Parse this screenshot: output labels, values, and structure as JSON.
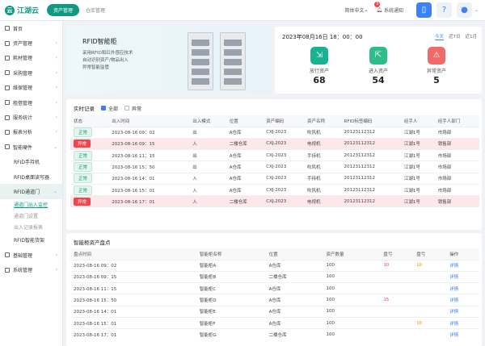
{
  "app": {
    "logo_mark": "云",
    "logo": "江湖云",
    "nav": [
      "资产管理",
      "仓库管理"
    ]
  },
  "topbar": {
    "lang": "简体中文",
    "notify": "系统通知",
    "notify_count": "5"
  },
  "sidebar": {
    "items": [
      {
        "label": "首页",
        "type": "top"
      },
      {
        "label": "资产管理",
        "type": "top",
        "chev": "›"
      },
      {
        "label": "耗材管理",
        "type": "top",
        "chev": "›"
      },
      {
        "label": "采购管理",
        "type": "top",
        "chev": "›"
      },
      {
        "label": "维保管理",
        "type": "top",
        "chev": "›"
      },
      {
        "label": "租借管理",
        "type": "top",
        "chev": "›"
      },
      {
        "label": "服务统计",
        "type": "top",
        "chev": "›"
      },
      {
        "label": "报表分析",
        "type": "top",
        "chev": "›"
      },
      {
        "label": "智能硬件",
        "type": "top",
        "chev": "⌄"
      },
      {
        "label": "RFID手持机",
        "type": "sub"
      },
      {
        "label": "RFID桌面读写器",
        "type": "sub"
      },
      {
        "label": "RFID通道门",
        "type": "subsel",
        "chev": "⌄"
      },
      {
        "label": "通道门出入监控",
        "type": "leafsel"
      },
      {
        "label": "通道门设置",
        "type": "leaf"
      },
      {
        "label": "出入记录报表",
        "type": "leaf"
      },
      {
        "label": "RFID智能货架",
        "type": "sub"
      },
      {
        "label": "基础管理",
        "type": "top",
        "chev": "›"
      },
      {
        "label": "系统管理",
        "type": "top",
        "chev": "›"
      }
    ]
  },
  "hero": {
    "title": "RFID智能柜",
    "lines": [
      "采用RFID和红外感应技术",
      "自动识别资产/物品出入",
      "异常智能监管"
    ]
  },
  "stats": {
    "date": "2023年08月16日   18：00：00",
    "tabs": [
      "今天",
      "近7日",
      "近1月"
    ],
    "cards": [
      {
        "label": "放行资产",
        "value": "68",
        "color": "#19b28f",
        "icon": "⇲"
      },
      {
        "label": "进入资产",
        "value": "54",
        "color": "#2dbd8a",
        "icon": "⇱"
      },
      {
        "label": "异常资产",
        "value": "5",
        "color": "#f06a6a",
        "icon": "⚠"
      }
    ]
  },
  "realtime": {
    "title": "实时记录",
    "filter_all": "全部",
    "filter_abnormal": "异常",
    "columns": [
      "状态",
      "出入时间",
      "出入模式",
      "位置",
      "资产编码",
      "资产名称",
      "RFID标签编码",
      "经手人",
      "经手人部门"
    ],
    "rows": [
      {
        "status": "正常",
        "time": "2023-08-16  09：02",
        "mode": "出",
        "loc": "A仓库",
        "code": "CXJ-2023",
        "name": "吹风机",
        "rfid": "20123112312",
        "person": "江湖1号",
        "dept": "市场部",
        "abnormal": false
      },
      {
        "status": "异常",
        "time": "2023-08-16  09：15",
        "mode": "入",
        "loc": "二楼仓库",
        "code": "CXJ-2023",
        "name": "电视机",
        "rfid": "20123112312",
        "person": "江湖1号",
        "dept": "销售部",
        "abnormal": true
      },
      {
        "status": "正常",
        "time": "2023-08-16  11：15",
        "mode": "出",
        "loc": "A仓库",
        "code": "CXJ-2023",
        "name": "手持机",
        "rfid": "20123112312",
        "person": "江湖1号",
        "dept": "市场部",
        "abnormal": false
      },
      {
        "status": "正常",
        "time": "2023-08-16  15：50",
        "mode": "出",
        "loc": "A仓库",
        "code": "CXJ-2023",
        "name": "吹风机",
        "rfid": "20123112312",
        "person": "江湖1号",
        "dept": "市场部",
        "abnormal": false
      },
      {
        "status": "正常",
        "time": "2023-08-16  14：01",
        "mode": "入",
        "loc": "A仓库",
        "code": "CXJ-2023",
        "name": "手持机",
        "rfid": "20123112312",
        "person": "江湖1号",
        "dept": "市场部",
        "abnormal": false
      },
      {
        "status": "正常",
        "time": "2023-08-16  15：01",
        "mode": "入",
        "loc": "A仓库",
        "code": "CXJ-2023",
        "name": "吹风机",
        "rfid": "20123112312",
        "person": "江湖1号",
        "dept": "市场部",
        "abnormal": false
      },
      {
        "status": "异常",
        "time": "2023-08-16  17：01",
        "mode": "入",
        "loc": "二楼仓库",
        "code": "CXJ-2023",
        "name": "电视机",
        "rfid": "20123112312",
        "person": "江湖1号",
        "dept": "销售部",
        "abnormal": true
      }
    ]
  },
  "inventory": {
    "title": "智能柜资产盘点",
    "columns": [
      "盘点时间",
      "智能柜名称",
      "位置",
      "资产数量",
      "盘亏",
      "盘亏",
      "操作"
    ],
    "rows": [
      {
        "time": "2023-08-16  09：02",
        "name": "智能柜A",
        "loc": "A仓库",
        "qty": "100",
        "loss": "10",
        "gain": "10",
        "op": "详情"
      },
      {
        "time": "2023-08-16  09：15",
        "name": "智能柜B",
        "loc": "二楼仓库",
        "qty": "100",
        "loss": "",
        "gain": "",
        "op": "详情"
      },
      {
        "time": "2023-08-16  11：15",
        "name": "智能柜C",
        "loc": "A仓库",
        "qty": "100",
        "loss": "",
        "gain": "",
        "op": "详情"
      },
      {
        "time": "2023-08-16  15：50",
        "name": "智能柜D",
        "loc": "A仓库",
        "qty": "100",
        "loss": "15",
        "gain": "",
        "op": "详情"
      },
      {
        "time": "2023-08-16  14：01",
        "name": "智能柜E",
        "loc": "A仓库",
        "qty": "100",
        "loss": "",
        "gain": "",
        "op": "详情"
      },
      {
        "time": "2023-08-16  15：01",
        "name": "智能柜F",
        "loc": "A仓库",
        "qty": "100",
        "loss": "",
        "gain": "10",
        "op": "详情"
      },
      {
        "time": "2023-08-16  17：01",
        "name": "智能柜G",
        "loc": "二楼仓库",
        "qty": "100",
        "loss": "",
        "gain": "",
        "op": "详情"
      }
    ]
  }
}
